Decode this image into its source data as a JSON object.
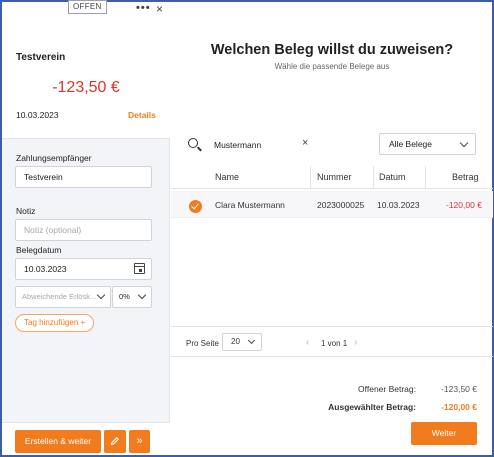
{
  "left": {
    "status_badge": "OFFEN",
    "more_label": "•••",
    "close_label": "×",
    "vendor_name": "Testverein",
    "amount": "-123,50 €",
    "date": "10.03.2023",
    "details_link": "Details",
    "payee_label": "Zahlungsempfänger",
    "payee_value": "Testverein",
    "note_label": "Notiz",
    "note_placeholder": "Notiz (optional)",
    "doc_date_label": "Belegdatum",
    "doc_date_value": "10.03.2023",
    "revenue_account_placeholder": "Abweichende Erlösk...",
    "tax_rate_value": "0%",
    "add_tag_label": "Tag hinzufügen +",
    "create_button": "Erstellen & weiter",
    "edit_icon": "pencil-icon",
    "forward_label": "»"
  },
  "main": {
    "title": "Welchen Beleg willst du zuweisen?",
    "subtitle": "Wähle die passende Belege aus",
    "search_value": "Mustermann",
    "clear_label": "×",
    "filter_value": "Alle Belege",
    "columns": [
      "Name",
      "Nummer",
      "Datum",
      "Betrag"
    ],
    "rows": [
      {
        "name": "Clara Mustermann",
        "number": "2023000025",
        "date": "10.03.2023",
        "amount": "-120,00 €",
        "selected": true
      }
    ],
    "per_page_label": "Pro Seite",
    "per_page_value": "20",
    "page_prev": "‹",
    "page_info": "1 von 1",
    "page_next": "›",
    "open_amount_label": "Offener Betrag:",
    "open_amount_value": "-123,50 €",
    "selected_amount_label": "Ausgewählter Betrag:",
    "selected_amount_value": "-120,00 €",
    "next_button": "Weiter"
  },
  "colors": {
    "accent": "#f07c1e",
    "negative": "#e2322b",
    "frame": "#3b5eac"
  }
}
